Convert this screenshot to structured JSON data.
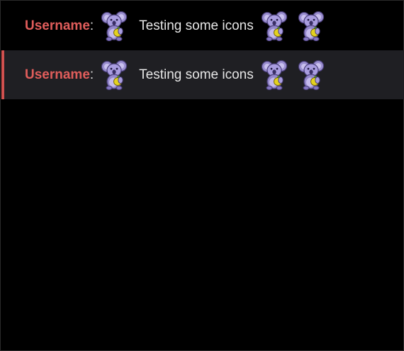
{
  "chat": {
    "messages": [
      {
        "username": "Username",
        "separator": ":",
        "text": "Testing some icons",
        "emote_icon": "koala-emote-icon",
        "highlighted": false
      },
      {
        "username": "Username",
        "separator": ":",
        "text": "Testing some icons",
        "emote_icon": "koala-emote-icon",
        "highlighted": true
      }
    ]
  },
  "colors": {
    "background": "#000000",
    "highlight_row": "#1f1f23",
    "highlight_bar": "#d0514f",
    "username": "#e05d5b",
    "text": "#e6e6e6"
  }
}
